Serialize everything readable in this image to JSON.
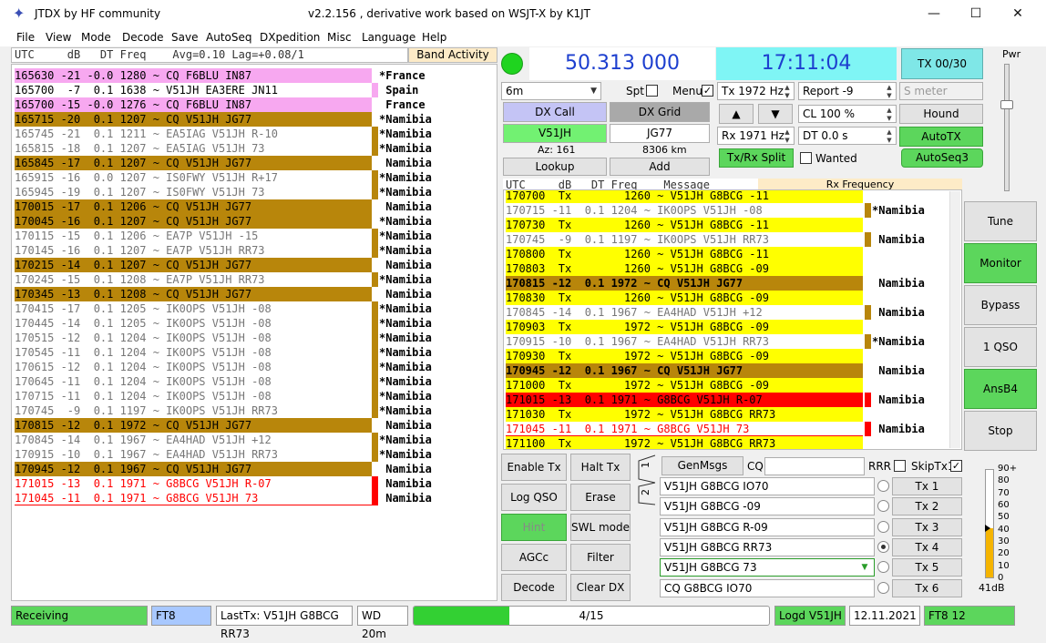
{
  "title": {
    "app": "JTDX   by HF community",
    "version": "v2.2.156 , derivative work based on WSJT-X by K1JT"
  },
  "window_controls": {
    "minimize": "—",
    "maximize": "☐",
    "close": "✕"
  },
  "menu": [
    "File",
    "View",
    "Mode",
    "Decode",
    "Save",
    "AutoSeq",
    "DXpedition",
    "Misc",
    "Language",
    "Help"
  ],
  "band_activity": {
    "header": "UTC     dB   DT Freq    Avg=0.10 Lag=+0.08/1",
    "tab_label": "Band Activity",
    "rows": [
      {
        "msg": "165630 -21 -0.0 1280 ~ CQ F6BLU IN87",
        "country": "*France",
        "style": "pink"
      },
      {
        "msg": "165700  -7  0.1 1638 ~ V51JH EA3ERE JN11",
        "country": " Spain",
        "style": "white"
      },
      {
        "msg": "165700 -15 -0.0 1276 ~ CQ F6BLU IN87",
        "country": " France",
        "style": "pink"
      },
      {
        "msg": "165715 -20  0.1 1207 ~ CQ V51JH JG77",
        "country": "*Namibia",
        "style": "brown"
      },
      {
        "msg": "165745 -21  0.1 1211 ~ EA5IAG V51JH R-10",
        "country": "*Namibia",
        "style": "gray"
      },
      {
        "msg": "165815 -18  0.1 1207 ~ EA5IAG V51JH 73",
        "country": "*Namibia",
        "style": "gray"
      },
      {
        "msg": "165845 -17  0.1 1207 ~ CQ V51JH JG77",
        "country": " Namibia",
        "style": "brown"
      },
      {
        "msg": "165915 -16  0.0 1207 ~ IS0FWY V51JH R+17",
        "country": "*Namibia",
        "style": "gray"
      },
      {
        "msg": "165945 -19  0.1 1207 ~ IS0FWY V51JH 73",
        "country": "*Namibia",
        "style": "gray"
      },
      {
        "msg": "170015 -17  0.1 1206 ~ CQ V51JH JG77",
        "country": " Namibia",
        "style": "brown"
      },
      {
        "msg": "170045 -16  0.1 1207 ~ CQ V51JH JG77",
        "country": "*Namibia",
        "style": "brown"
      },
      {
        "msg": "170115 -15  0.1 1206 ~ EA7P V51JH -15",
        "country": "*Namibia",
        "style": "gray"
      },
      {
        "msg": "170145 -16  0.1 1207 ~ EA7P V51JH RR73",
        "country": "*Namibia",
        "style": "gray"
      },
      {
        "msg": "170215 -14  0.1 1207 ~ CQ V51JH JG77",
        "country": " Namibia",
        "style": "brown"
      },
      {
        "msg": "170245 -15  0.1 1208 ~ EA7P V51JH RR73",
        "country": "*Namibia",
        "style": "gray"
      },
      {
        "msg": "170345 -13  0.1 1208 ~ CQ V51JH JG77",
        "country": " Namibia",
        "style": "brown"
      },
      {
        "msg": "170415 -17  0.1 1205 ~ IK0OPS V51JH -08",
        "country": "*Namibia",
        "style": "gray"
      },
      {
        "msg": "170445 -14  0.1 1205 ~ IK0OPS V51JH -08",
        "country": "*Namibia",
        "style": "gray"
      },
      {
        "msg": "170515 -12  0.1 1204 ~ IK0OPS V51JH -08",
        "country": "*Namibia",
        "style": "gray"
      },
      {
        "msg": "170545 -11  0.1 1204 ~ IK0OPS V51JH -08",
        "country": "*Namibia",
        "style": "gray"
      },
      {
        "msg": "170615 -12  0.1 1204 ~ IK0OPS V51JH -08",
        "country": "*Namibia",
        "style": "gray"
      },
      {
        "msg": "170645 -11  0.1 1204 ~ IK0OPS V51JH -08",
        "country": "*Namibia",
        "style": "gray"
      },
      {
        "msg": "170715 -11  0.1 1204 ~ IK0OPS V51JH -08",
        "country": "*Namibia",
        "style": "gray"
      },
      {
        "msg": "170745  -9  0.1 1197 ~ IK0OPS V51JH RR73",
        "country": "*Namibia",
        "style": "gray"
      },
      {
        "msg": "170815 -12  0.1 1972 ~ CQ V51JH JG77",
        "country": " Namibia",
        "style": "brown"
      },
      {
        "msg": "170845 -14  0.1 1967 ~ EA4HAD V51JH +12",
        "country": "*Namibia",
        "style": "gray"
      },
      {
        "msg": "170915 -10  0.1 1967 ~ EA4HAD V51JH RR73",
        "country": "*Namibia",
        "style": "gray"
      },
      {
        "msg": "170945 -12  0.1 1967 ~ CQ V51JH JG77",
        "country": " Namibia",
        "style": "brown"
      },
      {
        "msg": "171015 -13  0.1 1971 ~ G8BCG V51JH R-07",
        "country": " Namibia",
        "style": "red"
      },
      {
        "msg": "171045 -11  0.1 1971 ~ G8BCG V51JH 73",
        "country": " Namibia",
        "style": "redline"
      }
    ]
  },
  "controls": {
    "frequency": "50.313 000",
    "clock": "17:11:04",
    "tx_counter": "TX 00/30",
    "band": "6m",
    "spt_label": "Spt",
    "menu_label": "Menu",
    "menu_check": "✓",
    "tx_hz": "Tx  1972  Hz",
    "report": "Report -9",
    "smeter": "S meter",
    "dxcall_label": "DX Call",
    "dxgrid_label": "DX Grid",
    "dxcall": "V51JH",
    "dxgrid": "JG77",
    "az": "Az: 161",
    "km": "8306 km",
    "lookup": "Lookup",
    "add": "Add",
    "up_arrow": "▲",
    "down_arrow": "▼",
    "cl": "CL  100 %",
    "hound": "Hound",
    "rx_hz": "Rx  1971  Hz",
    "dt": "DT 0.0 s",
    "autotx": "AutoTX",
    "txrx_split": "Tx/Rx Split",
    "wanted": "Wanted",
    "autoseq": "AutoSeq3",
    "pwr": "Pwr"
  },
  "rx_frequency": {
    "header": "UTC     dB   DT Freq    Message",
    "tab_label": "Rx Frequency",
    "rows": [
      {
        "msg": "170700  Tx        1260 ~ V51JH G8BCG -11",
        "country": "",
        "style": "yellow"
      },
      {
        "msg": "170715 -11  0.1 1204 ~ IK0OPS V51JH -08",
        "country": "*Namibia",
        "style": "gray"
      },
      {
        "msg": "170730  Tx        1260 ~ V51JH G8BCG -11",
        "country": "",
        "style": "yellow"
      },
      {
        "msg": "170745  -9  0.1 1197 ~ IK0OPS V51JH RR73",
        "country": " Namibia",
        "style": "gray"
      },
      {
        "msg": "170800  Tx        1260 ~ V51JH G8BCG -11",
        "country": "",
        "style": "yellow"
      },
      {
        "msg": "170803  Tx        1260 ~ V51JH G8BCG -09",
        "country": "",
        "style": "yellow"
      },
      {
        "msg": "170815 -12  0.1 1972 ~ CQ V51JH JG77",
        "country": " Namibia",
        "style": "brown"
      },
      {
        "msg": "170830  Tx        1260 ~ V51JH G8BCG -09",
        "country": "",
        "style": "yellow"
      },
      {
        "msg": "170845 -14  0.1 1967 ~ EA4HAD V51JH +12",
        "country": " Namibia",
        "style": "gray"
      },
      {
        "msg": "170903  Tx        1972 ~ V51JH G8BCG -09",
        "country": "",
        "style": "yellow"
      },
      {
        "msg": "170915 -10  0.1 1967 ~ EA4HAD V51JH RR73",
        "country": "*Namibia",
        "style": "gray"
      },
      {
        "msg": "170930  Tx        1972 ~ V51JH G8BCG -09",
        "country": "",
        "style": "yellow"
      },
      {
        "msg": "170945 -12  0.1 1967 ~ CQ V51JH JG77",
        "country": " Namibia",
        "style": "brown"
      },
      {
        "msg": "171000  Tx        1972 ~ V51JH G8BCG -09",
        "country": "",
        "style": "yellow"
      },
      {
        "msg": "171015 -13  0.1 1971 ~ G8BCG V51JH R-07",
        "country": " Namibia",
        "style": "red"
      },
      {
        "msg": "171030  Tx        1972 ~ V51JH G8BCG RR73",
        "country": "",
        "style": "yellow"
      },
      {
        "msg": "171045 -11  0.1 1971 ~ G8BCG V51JH 73",
        "country": " Namibia",
        "style": "redline"
      },
      {
        "msg": "171100  Tx        1972 ~ V51JH G8BCG RR73",
        "country": "",
        "style": "yellow"
      }
    ]
  },
  "bottom_buttons": {
    "enable_tx": "Enable Tx",
    "halt_tx": "Halt Tx",
    "log_qso": "Log QSO",
    "erase": "Erase",
    "hint": "Hint",
    "swl_mode": "SWL mode",
    "agcc": "AGCc",
    "filter": "Filter",
    "decode": "Decode",
    "clear_dx": "Clear DX"
  },
  "tx_messages": {
    "tab1": "1",
    "tab2": "2",
    "genmsgs": "GenMsgs",
    "cq_label": "CQ",
    "rrr_label": "RRR",
    "skiptx1": "SkipTx1",
    "skiptx1_check": "✓",
    "msgs": [
      "V51JH G8BCG IO70",
      "V51JH G8BCG -09",
      "V51JH G8BCG R-09",
      "V51JH G8BCG RR73",
      "V51JH G8BCG 73",
      "CQ G8BCG IO70"
    ],
    "tx_labels": [
      "Tx 1",
      "Tx 2",
      "Tx 3",
      "Tx 4",
      "Tx 5",
      "Tx 6"
    ],
    "selected": 3
  },
  "side_buttons": [
    "Tune",
    "Monitor",
    "Bypass",
    "1 QSO",
    "AnsB4",
    "Stop"
  ],
  "meter": {
    "ticks": [
      "90+",
      "80",
      "70",
      "60",
      "50",
      "40",
      "30",
      "20",
      "10",
      "0"
    ],
    "level_db": 41,
    "readout": "41dB"
  },
  "statusbar": {
    "state": "Receiving",
    "mode": "FT8",
    "last_tx": "LastTx: V51JH G8BCG RR73",
    "wd": "WD 20m",
    "progress_text": "4/15",
    "progress": 0.27,
    "logd": "Logd V51JH",
    "date": "12.11.2021",
    "period": "FT8  12"
  },
  "colors": {
    "pink": "#f7a8f0",
    "brown": "#b8860b",
    "gray_text": "#777777",
    "red": "#ff0000",
    "yellow": "#ffff00",
    "green": "#5cd65c",
    "cyan": "#7ff5f5",
    "freq_blue": "#1d3fcf"
  }
}
